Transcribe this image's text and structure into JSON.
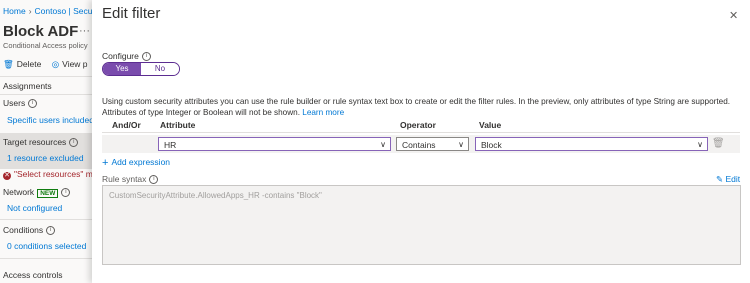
{
  "left": {
    "breadcrumb": [
      "Home",
      "Contoso | Secu"
    ],
    "title": "Block ADF",
    "more": "···",
    "subtitle": "Conditional Access policy",
    "delete_label": "Delete",
    "view_label": "View p",
    "assignments": "Assignments",
    "users_label": "Users",
    "users_value": "Specific users included",
    "target_label": "Target resources",
    "target_value": "1 resource excluded",
    "error_text": "\"Select resources\" mus",
    "network_label": "Network",
    "new_badge": "NEW",
    "network_value": "Not configured",
    "conditions_label": "Conditions",
    "conditions_value": "0 conditions selected",
    "access_controls": "Access controls"
  },
  "panel": {
    "title": "Edit filter",
    "close": "✕",
    "configure_label": "Configure",
    "toggle_yes": "Yes",
    "toggle_no": "No",
    "description": "Using custom security attributes you can use the rule builder or rule syntax text box to create or edit the filter rules. In the preview, only attributes of type String are supported. Attributes of type Integer or Boolean will not be shown.",
    "learn_more": "Learn more",
    "columns": {
      "andor": "And/Or",
      "attribute": "Attribute",
      "operator": "Operator",
      "value": "Value"
    },
    "row": {
      "attribute": "HR",
      "operator": "Contains",
      "value": "Block"
    },
    "add_expression": "Add expression",
    "rule_syntax_label": "Rule syntax",
    "edit_label": "Edit",
    "rule_syntax": "CustomSecurityAttribute.AllowedApps_HR -contains \"Block\""
  },
  "colors": {
    "accent": "#0078d4",
    "toggle": "#7a4cad",
    "error": "#a4262c"
  }
}
